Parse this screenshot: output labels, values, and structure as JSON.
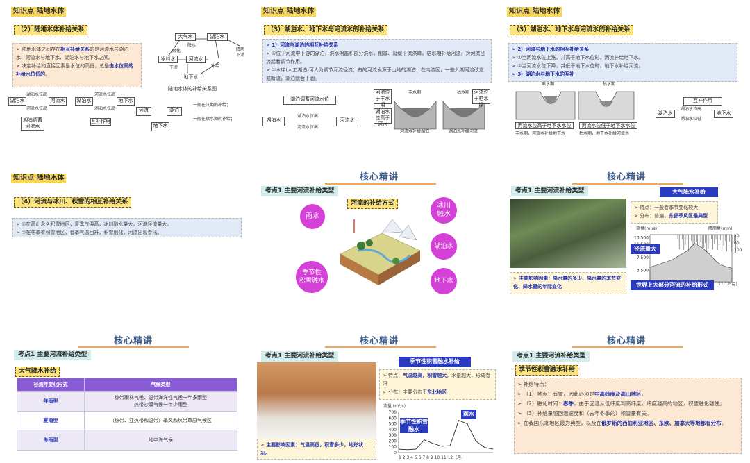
{
  "colors": {
    "accent_yellow": "#fbe37e",
    "title_blue": "#2a3bbf",
    "circle_magenta": "#d341d6",
    "purple_header": "#8a5bd6",
    "peach_note": "#fde8d3",
    "blue_note": "#e3eaf7"
  },
  "s1": {
    "kp": "知识点 陆地水体",
    "sec": "（2）陆地水体补给关系",
    "note_a_pre": "陆地水体之间存在",
    "note_a_hl": "相互补给关系",
    "note_a_post": "的是河流水与湖泊水、河流水与地下水、湖泊水与地下水之间。",
    "note_b_pre": "决定补给的直接因素是水位的高低，总是",
    "note_b_hl": "由水位高的补给水位低的",
    "note_b_post": "。",
    "diag_caption": "陆地水体的补给关系图",
    "diag_nodes": {
      "atmo": "大气水",
      "lake": "湖泊水",
      "river": "河流水",
      "glacier": "冰川水",
      "ground": "地下水",
      "mirror": "降雨下渗"
    },
    "diag_edges": {
      "melt": "融化",
      "rain": "降水",
      "evap": "蒸发",
      "seep": "下渗",
      "supply": "补给",
      "pour": "注入"
    },
    "row": {
      "lake": "湖泊水",
      "river": "河流水",
      "lake_hi": "湖泊水位高",
      "river_hi": "河流水位高",
      "river_lvl": "河流水位高",
      "lake_lvl": "湖泊水位高",
      "regulate": "湖泊调蓄河流水",
      "mutual": "互补作用",
      "river2": "河流",
      "lake2": "湖泊",
      "ground": "地下水",
      "flood": "一般在汛期的补给；",
      "dry": "一般在枯水期的补给；"
    }
  },
  "s2": {
    "kp": "知识点 陆地水体",
    "sec": "（3）湖泊水、地下水与河流水的补给关系",
    "n_title": "1）河流与湖泊的相互补给关系",
    "n1": "①位于河流中下游的湖泊，洪水期蓄积部分洪水，削减、延缓干流洪峰，枯水期补给河流，对河流径流起着调节作用。",
    "n2": "②水库(人工湖泊)可人为调节河流径流；有的河流发源于山地的湖泊；在内流区，一些入湖河流改道或断流，湖泊就会干涸。",
    "top_box": "湖泊调蓄河流水位",
    "lake": "湖泊水",
    "river": "河流水",
    "river_hi": "湖泊水位高",
    "lake_hi": "河流水位高",
    "x_labels": [
      "河流位于丰水期",
      "湖泊水位高于河水",
      "丰水期",
      "枯水期",
      "河流位于枯水期"
    ],
    "cap_a": "河流水补给湖泊",
    "cap_b": "湖泊水补给河流"
  },
  "s3": {
    "kp": "知识点 陆地水体",
    "sec": "（3）湖泊水、地下水与河流水的补给关系",
    "title": "2）河流与地下水的相互补给关系",
    "n1": "①当河流水位上涨，并高于地下水位时，河流补给地下水。",
    "n2": "②当河流水位下降，并低于地下水位时，地下水补给河流。",
    "n3": "3）湖泊水与地下水的互补",
    "labels": [
      "丰水期",
      "枯水期",
      "潜水位",
      "河流水",
      "潜水位",
      "地下水"
    ],
    "box_a": "河流水位高于地下水水位",
    "box_b": "河流水位低于地下水水位",
    "cap_a": "丰水期，河流水补给地下水",
    "cap_b": "枯水期，地下水补给河流水",
    "mutual": "互补作用",
    "lake": "湖泊水",
    "ground": "地下水",
    "lake_hi": "湖泊水位高",
    "lake_lo": "湖泊水位低"
  },
  "s4": {
    "kp": "知识点 陆地水体",
    "sec": "（4）河流与冰川、积雪的相互补给关系",
    "n1": "①在高山永久积雪地区，夏季气温高，冰川融水量大，河流径流量大。",
    "n2": "②在冬季有积雪地区，春季气温回升，积雪融化，河流出现春汛。"
  },
  "s5": {
    "heading": "核心精讲",
    "kd": "考点1 主要河流补给类型",
    "tag": "河流的补给方式",
    "circles": [
      "雨水",
      "冰川\n融水",
      "湖泊水",
      "季节性\n积雪融水",
      "地下水"
    ]
  },
  "s6": {
    "heading": "核心精讲",
    "kd": "考点1 主要河流补给类型",
    "title": "大气降水补给",
    "n1_pre": "特点：",
    "n1": "一般春季节变化较大",
    "n2_pre": "分布：",
    "n2": "普遍，",
    "n2_hl": "东部季风区最典型",
    "factor_pre": "主要影响因素：",
    "factor": "降水量的多少、降水量的季节变化、降水量的年际变化",
    "chart_ylabel": "流量(m³/s)",
    "chart_y2label": "降雨量(mm)",
    "legend": "径流量大",
    "bottom": "世界上大部分河流的补给形式",
    "months": "11 12(月)"
  },
  "s7": {
    "heading": "核心精讲",
    "kd": "考点1 主要河流补给类型",
    "title": "大气降水补给",
    "col1": "径流年变化形式",
    "col2": "气候类型",
    "rows": [
      {
        "type": "年雨型",
        "climate": "热带雨林气候、温带海洋性气候一年多雨型\n热带沙漠气候一年少雨型"
      },
      {
        "type": "夏雨型",
        "climate": "（热带、亚热带和温带）季风和热带草原气候区"
      },
      {
        "type": "冬雨型",
        "climate": "地中海气候"
      }
    ]
  },
  "s8": {
    "heading": "核心精讲",
    "kd": "考点1 主要河流补给类型",
    "title": "季节性积雪融水补给",
    "n1_pre": "特点：",
    "n1_hl": "气温越高，积雪越大",
    "n1_post": "，水量越大，形成春汛",
    "n2_pre": "分布：",
    "n2": "主要分布于",
    "n2_hl": "东北地区",
    "factor_pre": "主要影响因素：",
    "factor": "气温高低，积雪多少，地形状况。",
    "chart_ylabel": "流量 (m³/s)",
    "chart_legend": "季节性积雪融水",
    "chart_rain": "雨水",
    "months": "1 2 3 4 5 6 7 8 9 10 11 12（月）"
  },
  "s9": {
    "heading": "核心精讲",
    "kd": "考点1 主要河流补给类型",
    "title": "季节性积雪融水补给",
    "n0": "补给特点：",
    "n1_pre": "（1）地点：有雪，因此必须是",
    "n1_hl": "中高纬度及高山地区",
    "n1_post": "。",
    "n2_pre": "（2）融化时间：",
    "n2_hl": "春季",
    "n2_post": "，由于回温从低纬度到高纬度，纬度越高的地区，积雪融化越晚。",
    "n3": "（3）补给量随回温速度和（去年冬季的）积雪量有关。",
    "n4_pre": "在我国东北地区最为典型，以及在",
    "n4_hl": "俄罗斯的西伯利亚地区、东欧、加拿大等地都有分布",
    "n4_post": "。"
  },
  "chart_data": [
    {
      "type": "area",
      "title": "",
      "xlabel": "(月)",
      "ylabel": "流量(m³/s)",
      "y2label": "降雨量(mm)",
      "yticks": [
        3500,
        7500,
        11500,
        13500
      ],
      "y2ticks": [
        20,
        60,
        100
      ],
      "series": [
        {
          "name": "径流量",
          "x": [
            1,
            2,
            3,
            4,
            5,
            6,
            7,
            8,
            9,
            10,
            11,
            12
          ],
          "values": [
            4500,
            5200,
            6000,
            6800,
            8200,
            9500,
            11800,
            10500,
            8500,
            6000,
            4800,
            4200
          ]
        }
      ]
    },
    {
      "type": "line",
      "title": "",
      "xlabel": "（月）",
      "ylabel": "流量 (m³/s)",
      "ylim": [
        0,
        700
      ],
      "yticks": [
        0,
        100,
        200,
        300,
        400,
        500,
        600,
        700
      ],
      "categories": [
        "1",
        "2",
        "3",
        "4",
        "5",
        "6",
        "7",
        "8",
        "9",
        "10",
        "11",
        "12"
      ],
      "series": [
        {
          "name": "流量",
          "values": [
            60,
            50,
            60,
            220,
            160,
            110,
            120,
            560,
            500,
            200,
            90,
            60
          ]
        }
      ],
      "annotations": [
        "季节性积雪融水",
        "雨水"
      ]
    }
  ]
}
